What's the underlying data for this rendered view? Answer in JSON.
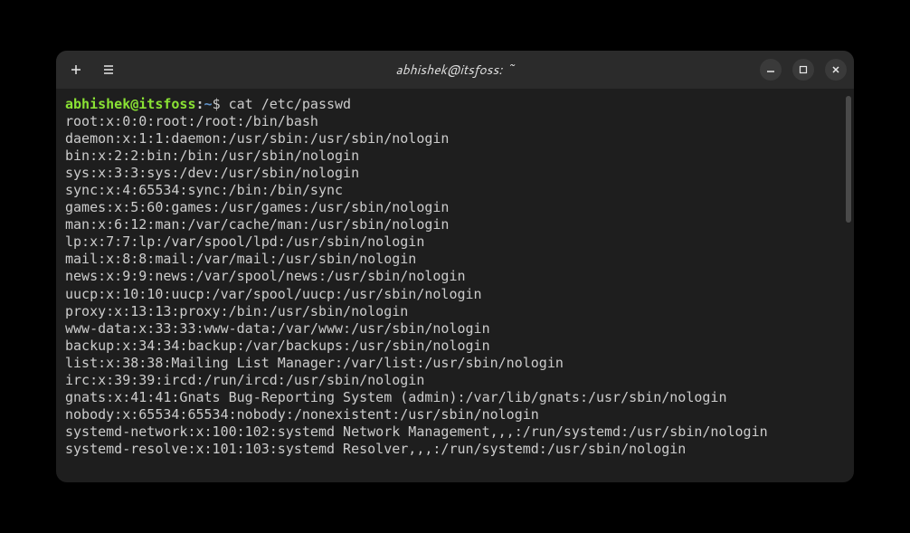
{
  "window": {
    "title": "abhishek@itsfoss: ~"
  },
  "prompt": {
    "user_host": "abhishek@itsfoss",
    "colon": ":",
    "path": "~",
    "symbol": "$ ",
    "command": "cat /etc/passwd"
  },
  "output": [
    "root:x:0:0:root:/root:/bin/bash",
    "daemon:x:1:1:daemon:/usr/sbin:/usr/sbin/nologin",
    "bin:x:2:2:bin:/bin:/usr/sbin/nologin",
    "sys:x:3:3:sys:/dev:/usr/sbin/nologin",
    "sync:x:4:65534:sync:/bin:/bin/sync",
    "games:x:5:60:games:/usr/games:/usr/sbin/nologin",
    "man:x:6:12:man:/var/cache/man:/usr/sbin/nologin",
    "lp:x:7:7:lp:/var/spool/lpd:/usr/sbin/nologin",
    "mail:x:8:8:mail:/var/mail:/usr/sbin/nologin",
    "news:x:9:9:news:/var/spool/news:/usr/sbin/nologin",
    "uucp:x:10:10:uucp:/var/spool/uucp:/usr/sbin/nologin",
    "proxy:x:13:13:proxy:/bin:/usr/sbin/nologin",
    "www-data:x:33:33:www-data:/var/www:/usr/sbin/nologin",
    "backup:x:34:34:backup:/var/backups:/usr/sbin/nologin",
    "list:x:38:38:Mailing List Manager:/var/list:/usr/sbin/nologin",
    "irc:x:39:39:ircd:/run/ircd:/usr/sbin/nologin",
    "gnats:x:41:41:Gnats Bug-Reporting System (admin):/var/lib/gnats:/usr/sbin/nologin",
    "nobody:x:65534:65534:nobody:/nonexistent:/usr/sbin/nologin",
    "systemd-network:x:100:102:systemd Network Management,,,:/run/systemd:/usr/sbin/nologin",
    "systemd-resolve:x:101:103:systemd Resolver,,,:/run/systemd:/usr/sbin/nologin"
  ]
}
